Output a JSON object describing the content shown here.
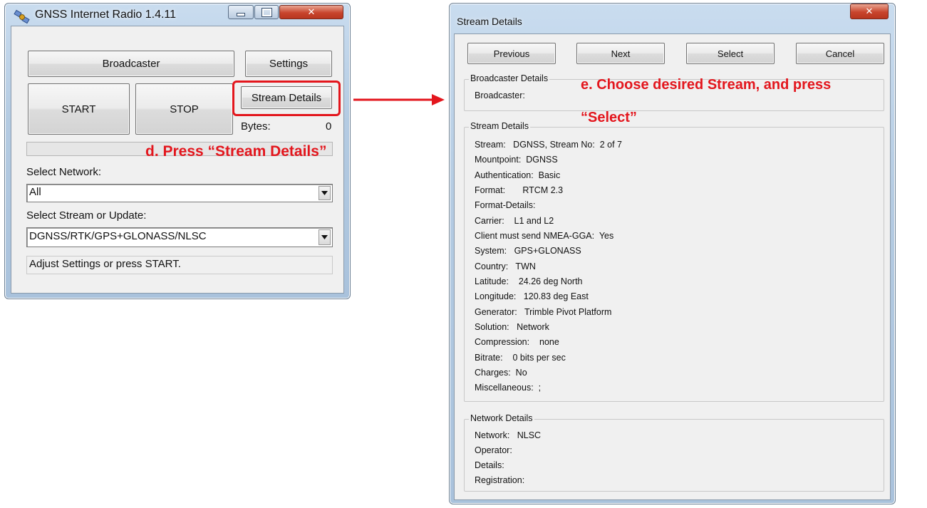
{
  "main_window": {
    "title": "GNSS Internet Radio 1.4.11",
    "broadcaster_label": "Broadcaster",
    "settings_label": "Settings",
    "start_label": "START",
    "stop_label": "STOP",
    "stream_details_label": "Stream Details",
    "bytes_label": "Bytes:",
    "bytes_value": "0",
    "select_network_label": "Select Network:",
    "network_value": "All",
    "select_stream_label": "Select Stream or Update:",
    "stream_value": "DGNSS/RTK/GPS+GLONASS/NLSC",
    "status_text": "Adjust Settings or press START."
  },
  "details_window": {
    "title": "Stream Details",
    "previous_label": "Previous",
    "next_label": "Next",
    "select_label": "Select",
    "cancel_label": "Cancel",
    "broadcaster_group": {
      "legend": "Broadcaster Details",
      "rows": [
        "Broadcaster:"
      ]
    },
    "stream_group": {
      "legend": "Stream Details",
      "rows": [
        "Stream:   DGNSS, Stream No:  2 of 7",
        "Mountpoint:  DGNSS",
        "Authentication:  Basic",
        "Format:       RTCM 2.3",
        "Format-Details:",
        "Carrier:    L1 and L2",
        "Client must send NMEA-GGA:  Yes",
        "System:   GPS+GLONASS",
        "Country:   TWN",
        "Latitude:    24.26 deg North",
        "Longitude:   120.83 deg East",
        "Generator:   Trimble Pivot Platform",
        "Solution:   Network",
        "Compression:    none",
        "Bitrate:    0 bits per sec",
        "Charges:  No",
        "Miscellaneous:  ;"
      ]
    },
    "network_group": {
      "legend": "Network Details",
      "rows": [
        "Network:   NLSC",
        "Operator:",
        "Details:",
        "Registration:"
      ]
    }
  },
  "annotations": {
    "step_d": "d. Press “Stream Details”",
    "step_e_line1": "e. Choose desired Stream, and press",
    "step_e_line2": "“Select”"
  },
  "colors": {
    "annotation_red": "#e3161d"
  }
}
